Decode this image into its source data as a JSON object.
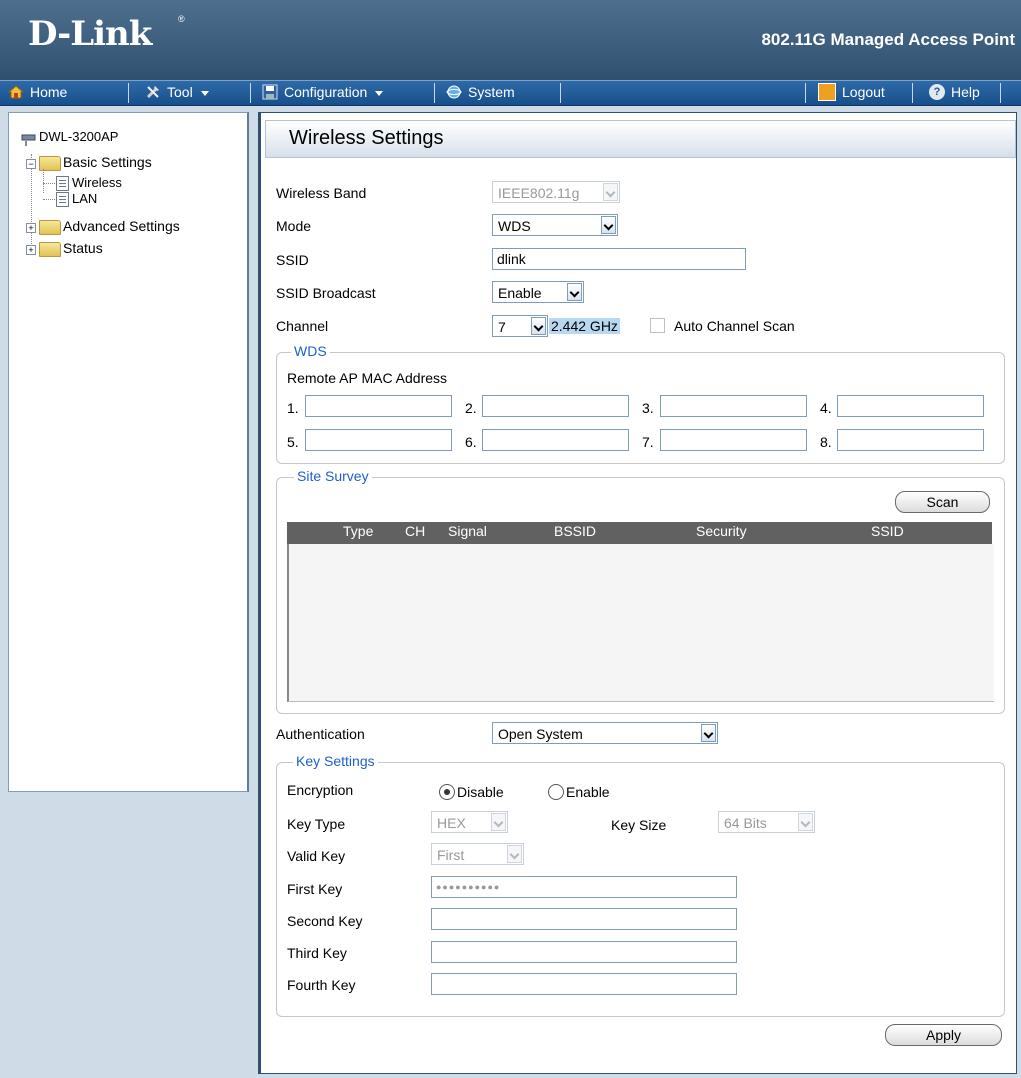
{
  "header": {
    "logo": "D-Link",
    "logo_mark": "®",
    "product": "802.11G Managed Access Point"
  },
  "menu": {
    "items": [
      {
        "label": "Home",
        "icon": "home-icon"
      },
      {
        "label": "Tool",
        "icon": "tool-icon"
      },
      {
        "label": "Configuration",
        "icon": "configuration-icon"
      },
      {
        "label": "System",
        "icon": "system-icon"
      }
    ],
    "logout": "Logout",
    "help": "Help"
  },
  "sidebar": {
    "device": "DWL-3200AP",
    "basic": "Basic Settings",
    "wireless": "Wireless",
    "lan": "LAN",
    "advanced": "Advanced Settings",
    "status": "Status"
  },
  "page": {
    "title": "Wireless Settings",
    "wireless_band_label": "Wireless Band",
    "wireless_band_value": "IEEE802.11g",
    "mode_label": "Mode",
    "mode_value": "WDS",
    "ssid_label": "SSID",
    "ssid_value": "dlink",
    "ssid_broadcast_label": "SSID Broadcast",
    "ssid_broadcast_value": "Enable",
    "channel_label": "Channel",
    "channel_value": "7",
    "channel_freq": "2.442 GHz",
    "auto_channel_scan": "Auto Channel Scan"
  },
  "wds": {
    "legend": "WDS",
    "remote_label": "Remote AP MAC Address",
    "numbers": [
      "1.",
      "2.",
      "3.",
      "4.",
      "5.",
      "6.",
      "7.",
      "8."
    ]
  },
  "site_survey": {
    "legend": "Site Survey",
    "scan_button": "Scan",
    "columns": [
      "Type",
      "CH",
      "Signal",
      "BSSID",
      "Security",
      "SSID"
    ]
  },
  "auth": {
    "label": "Authentication",
    "value": "Open System"
  },
  "key_settings": {
    "legend": "Key Settings",
    "encryption_label": "Encryption",
    "disable": "Disable",
    "enable": "Enable",
    "key_type_label": "Key Type",
    "key_type_value": "HEX",
    "key_size_label": "Key Size",
    "key_size_value": "64 Bits",
    "valid_key_label": "Valid Key",
    "valid_key_value": "First",
    "first_key_label": "First Key",
    "first_key_value": "●●●●●●●●●●",
    "second_key_label": "Second Key",
    "third_key_label": "Third Key",
    "fourth_key_label": "Fourth Key"
  },
  "apply_button": "Apply"
}
